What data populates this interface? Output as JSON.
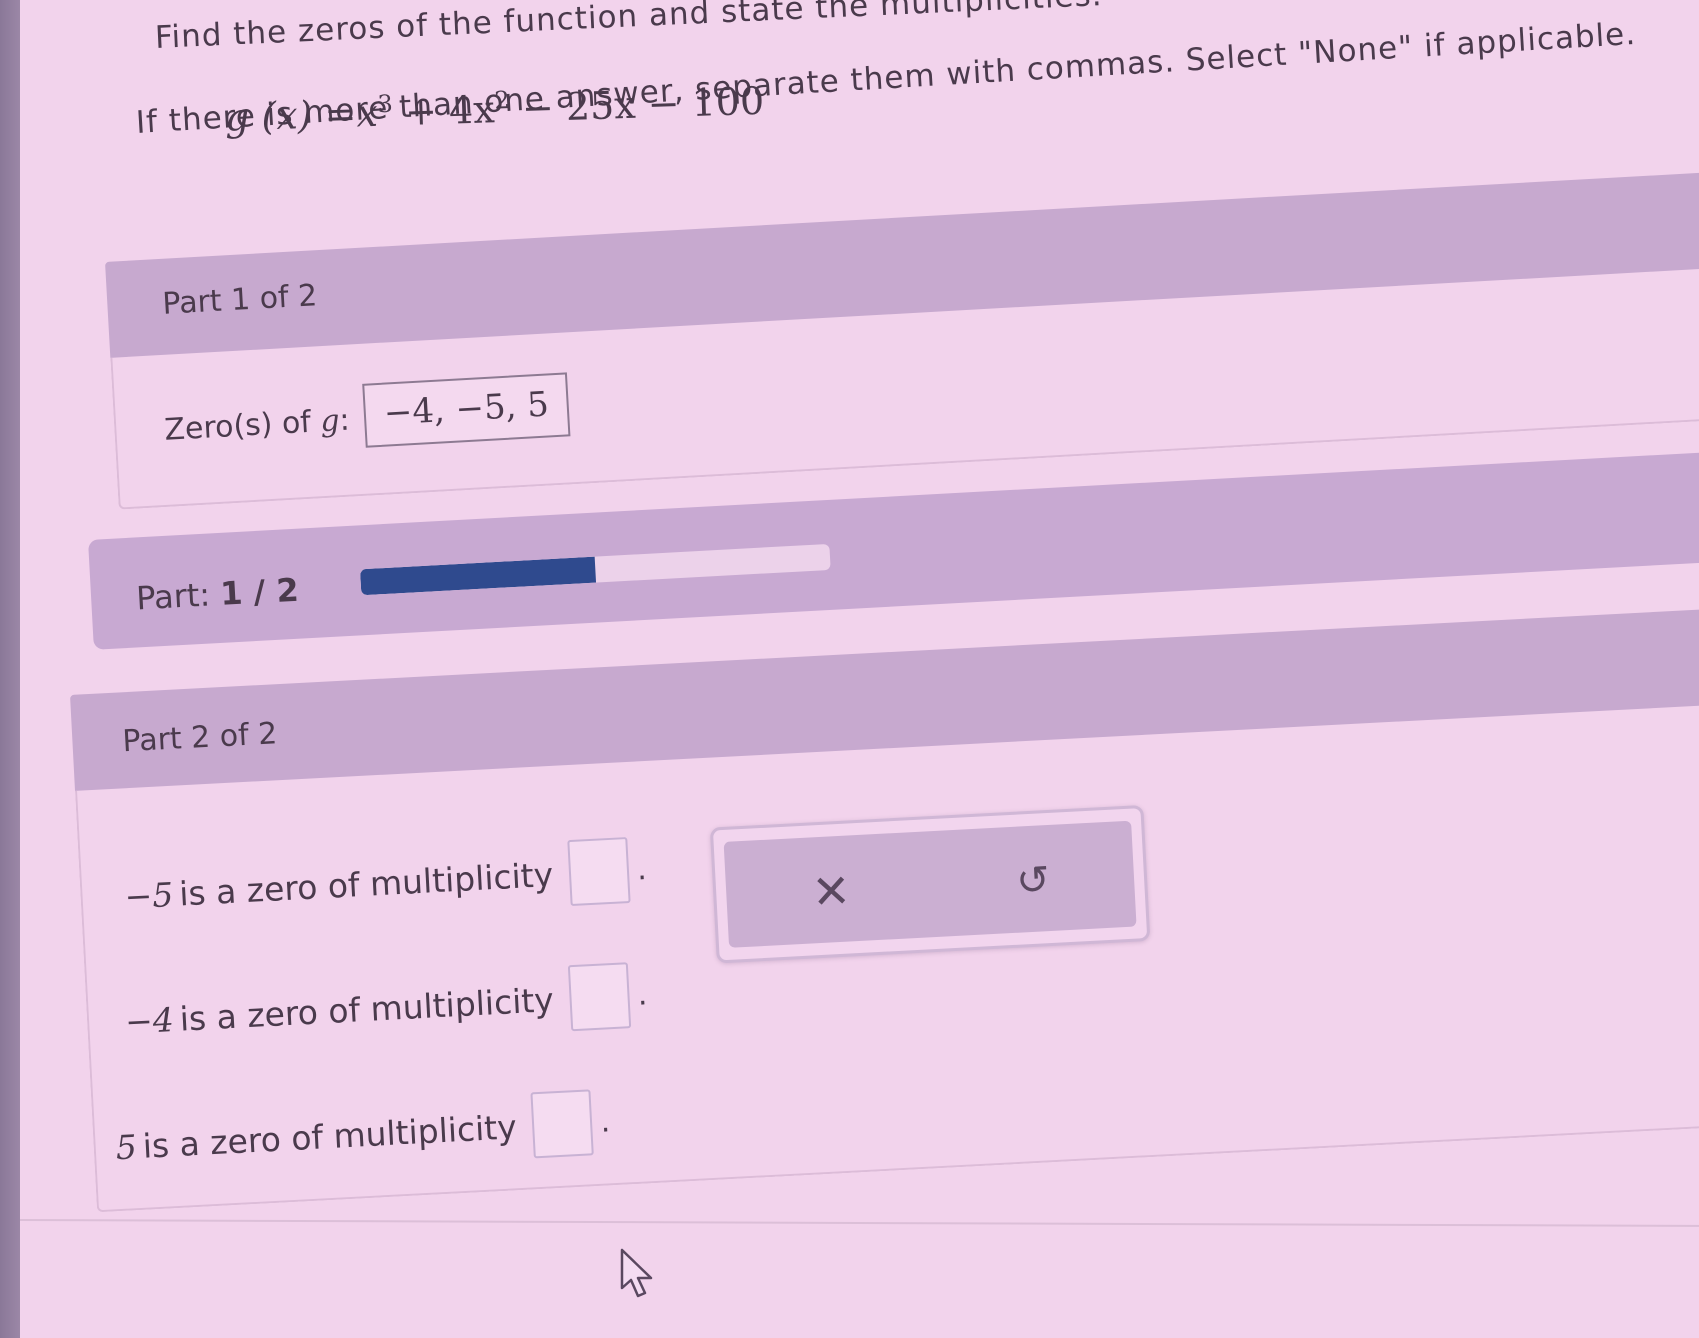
{
  "question": {
    "line1": "Find the zeros of the function and state the multiplicities.",
    "formula": {
      "lhs": "g (x) =",
      "var": "x",
      "exp1": "3",
      "term2": " + 4x",
      "exp2": "2",
      "tail": " − 25x − 100"
    },
    "line3": "If there is more than one answer, separate them with commas. Select \"None\" if applicable."
  },
  "part1": {
    "header": "Part 1 of 2",
    "zeros_label": "Zero(s) of ",
    "zeros_var": "g",
    "zeros_colon": ":",
    "zeros_answer": "−4, −5, 5"
  },
  "progress": {
    "label_prefix": "Part: ",
    "label_value": "1 / 2",
    "fraction": 0.5,
    "fill_color": "#2f4a8e"
  },
  "part2": {
    "header": "Part 2 of 2",
    "rows": [
      {
        "zero": "−5",
        "text": " is a zero of multiplicity",
        "value": ""
      },
      {
        "zero": "−4",
        "text": " is a zero of multiplicity",
        "value": ""
      },
      {
        "zero": "5",
        "text": " is a zero of multiplicity",
        "value": ""
      }
    ],
    "tools": {
      "clear_icon": "close-icon",
      "clear_glyph": "✕",
      "undo_icon": "undo-icon",
      "undo_glyph": "↺"
    }
  }
}
